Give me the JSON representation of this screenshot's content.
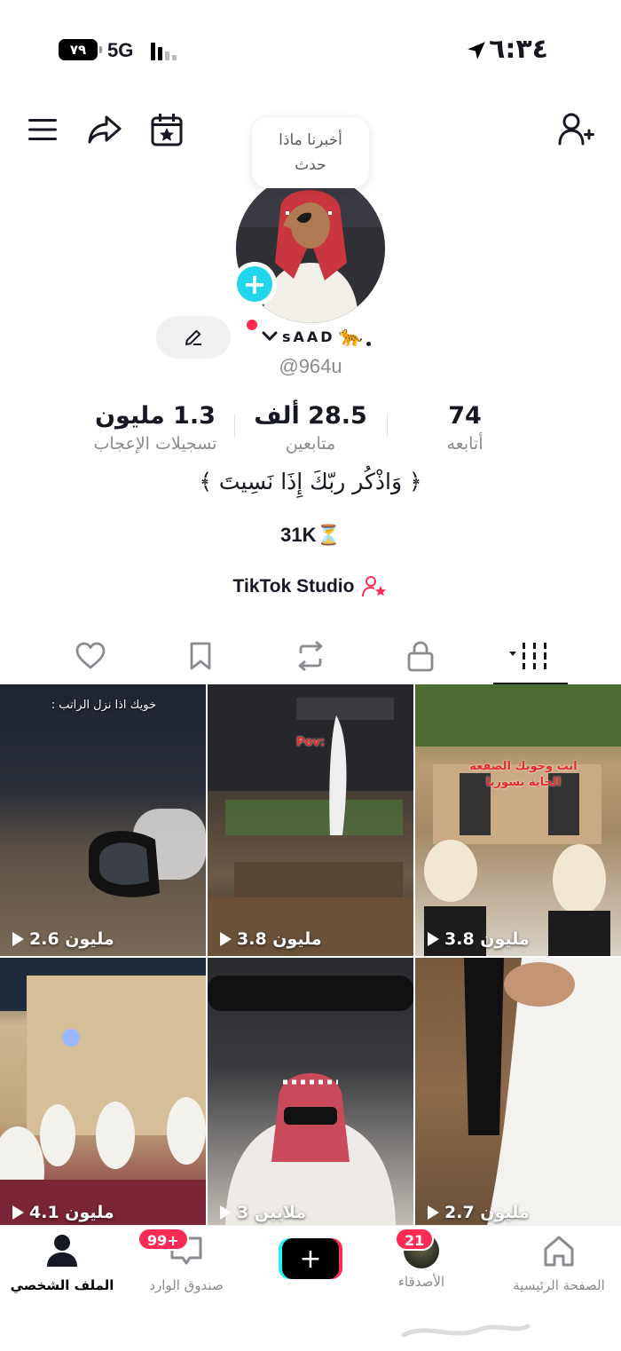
{
  "status_bar": {
    "battery": "٧٩",
    "network": "5G",
    "time": "٦:٣٤"
  },
  "note": {
    "text": "أخبرنا ماذا حدث"
  },
  "profile": {
    "display_name": "sAAD",
    "display_emoji": "🐆",
    "handle": "@964u",
    "bio": "﴿ وَاذْكُر ربّكَ إِذَا نَسِيتَ ﴾",
    "bio_line_2": "31K⏳",
    "studio_link": "TikTok Studio"
  },
  "stats": [
    {
      "value": "74",
      "label": "أتابعه"
    },
    {
      "value": "28.5 ألف",
      "label": "متابعين"
    },
    {
      "value": "1.3 مليون",
      "label": "تسجيلات الإعجاب"
    }
  ],
  "tabs": [
    {
      "icon": "grid-icon",
      "active": true
    },
    {
      "icon": "lock-icon",
      "active": false
    },
    {
      "icon": "repost-icon",
      "active": false
    },
    {
      "icon": "bookmark-icon",
      "active": false
    },
    {
      "icon": "heart-icon",
      "active": false
    }
  ],
  "videos": [
    {
      "views": "2.6 مليون",
      "caption": "خويك اذا نزل الراتب :"
    },
    {
      "views": "3.8 مليون",
      "caption": "Pov:"
    },
    {
      "views": "3.8 مليون",
      "caption": "انت وخويك الصفعة الجاية بسوريا"
    },
    {
      "views": "4.1 مليون",
      "caption": ""
    },
    {
      "views": "3 ملايين",
      "caption": ""
    },
    {
      "views": "2.7 مليون",
      "caption": ""
    }
  ],
  "bottom_nav": {
    "profile": "الملف الشخصي",
    "inbox": "صندوق الوارد",
    "inbox_badge": "99+",
    "friends": "الأصدقاء",
    "friends_badge": "21",
    "home": "الصفحة الرئيسية"
  },
  "colors": {
    "accent_red": "#fe2c55",
    "accent_cyan": "#25f4ee",
    "avatar_add": "#20d5ec"
  }
}
